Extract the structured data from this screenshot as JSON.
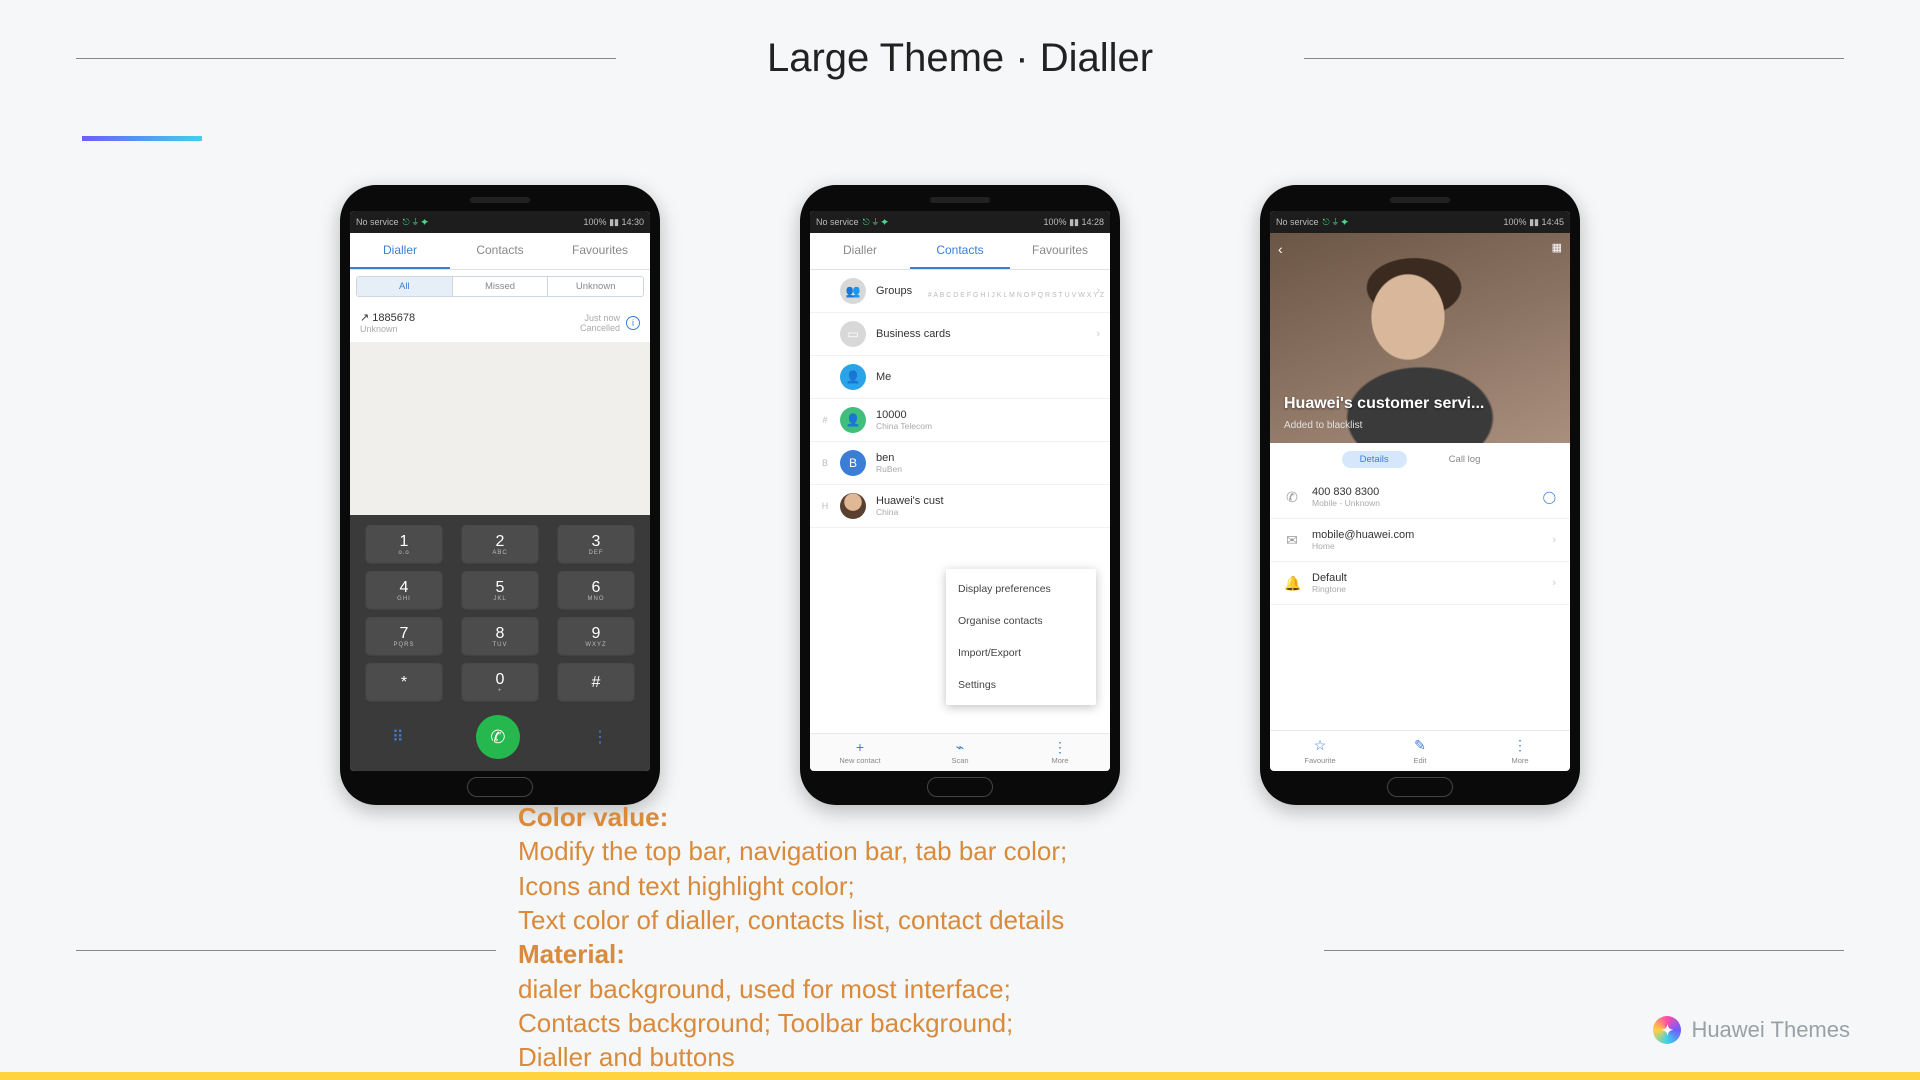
{
  "title": "Large Theme · Dialler",
  "status": {
    "left": "No service",
    "icons": "⎋ ⏚ ✦",
    "battery": "100%"
  },
  "times": [
    "14:30",
    "14:28",
    "14:45"
  ],
  "tabs": [
    "Dialler",
    "Contacts",
    "Favourites"
  ],
  "phone1": {
    "segs": [
      "All",
      "Missed",
      "Unknown"
    ],
    "call": {
      "number": "1885678",
      "sub": "Unknown",
      "when": "Just now",
      "state": "Cancelled"
    },
    "keys": [
      {
        "d": "1",
        "l": "o.o"
      },
      {
        "d": "2",
        "l": "ABC"
      },
      {
        "d": "3",
        "l": "DEF"
      },
      {
        "d": "4",
        "l": "GHI"
      },
      {
        "d": "5",
        "l": "JKL"
      },
      {
        "d": "6",
        "l": "MNO"
      },
      {
        "d": "7",
        "l": "PQRS"
      },
      {
        "d": "8",
        "l": "TUV"
      },
      {
        "d": "9",
        "l": "WXYZ"
      },
      {
        "d": "*",
        "l": ""
      },
      {
        "d": "0",
        "l": "+"
      },
      {
        "d": "#",
        "l": ""
      }
    ]
  },
  "phone2": {
    "items": [
      {
        "idx": "",
        "av": "gray",
        "avtxt": "👥",
        "t": "Groups",
        "s": "",
        "chev": true
      },
      {
        "idx": "",
        "av": "gray",
        "avtxt": "▭",
        "t": "Business cards",
        "s": "",
        "chev": true
      },
      {
        "idx": "",
        "av": "blue2",
        "avtxt": "👤",
        "t": "Me",
        "s": "",
        "chev": false
      },
      {
        "idx": "#",
        "av": "green",
        "avtxt": "👤",
        "t": "10000",
        "s": "China Telecom",
        "chev": false
      },
      {
        "idx": "B",
        "av": "blue",
        "avtxt": "B",
        "t": "ben",
        "s": "RuBen",
        "chev": false
      },
      {
        "idx": "H",
        "av": "face",
        "avtxt": "",
        "t": "Huawei's cust",
        "s": "China",
        "chev": false
      }
    ],
    "popup": [
      "Display preferences",
      "Organise contacts",
      "Import/Export",
      "Settings"
    ],
    "toolbar": [
      {
        "ic": "+",
        "lb": "New contact"
      },
      {
        "ic": "⌁",
        "lb": "Scan"
      },
      {
        "ic": "⋮",
        "lb": "More"
      }
    ],
    "az": "# A B C D E F G H I J K L M N O P Q R S T U V W X Y Z"
  },
  "phone3": {
    "name": "Huawei's customer servi...",
    "sub": "Added to blacklist",
    "pills": [
      "Details",
      "Call log"
    ],
    "rows": [
      {
        "ic": "✆",
        "t": "400 830 8300",
        "s": "Mobile - Unknown",
        "r": "◯"
      },
      {
        "ic": "✉",
        "t": "mobile@huawei.com",
        "s": "Home",
        "r": "›"
      },
      {
        "ic": "🔔",
        "t": "Default",
        "s": "Ringtone",
        "r": "›"
      }
    ],
    "toolbar": [
      {
        "ic": "☆",
        "lb": "Favourite"
      },
      {
        "ic": "✎",
        "lb": "Edit"
      },
      {
        "ic": "⋮",
        "lb": "More"
      }
    ]
  },
  "notes": {
    "h1": "Color value:",
    "l1": "Modify the top bar, navigation bar, tab bar color;",
    "l2": "Icons and text highlight color;",
    "l3": "Text color of dialler, contacts list, contact details",
    "h2": "Material:",
    "l4": "dialer background, used for most interface;",
    "l5": "Contacts background; Toolbar background;",
    "l6": "Dialler and buttons"
  },
  "brand": "Huawei Themes"
}
